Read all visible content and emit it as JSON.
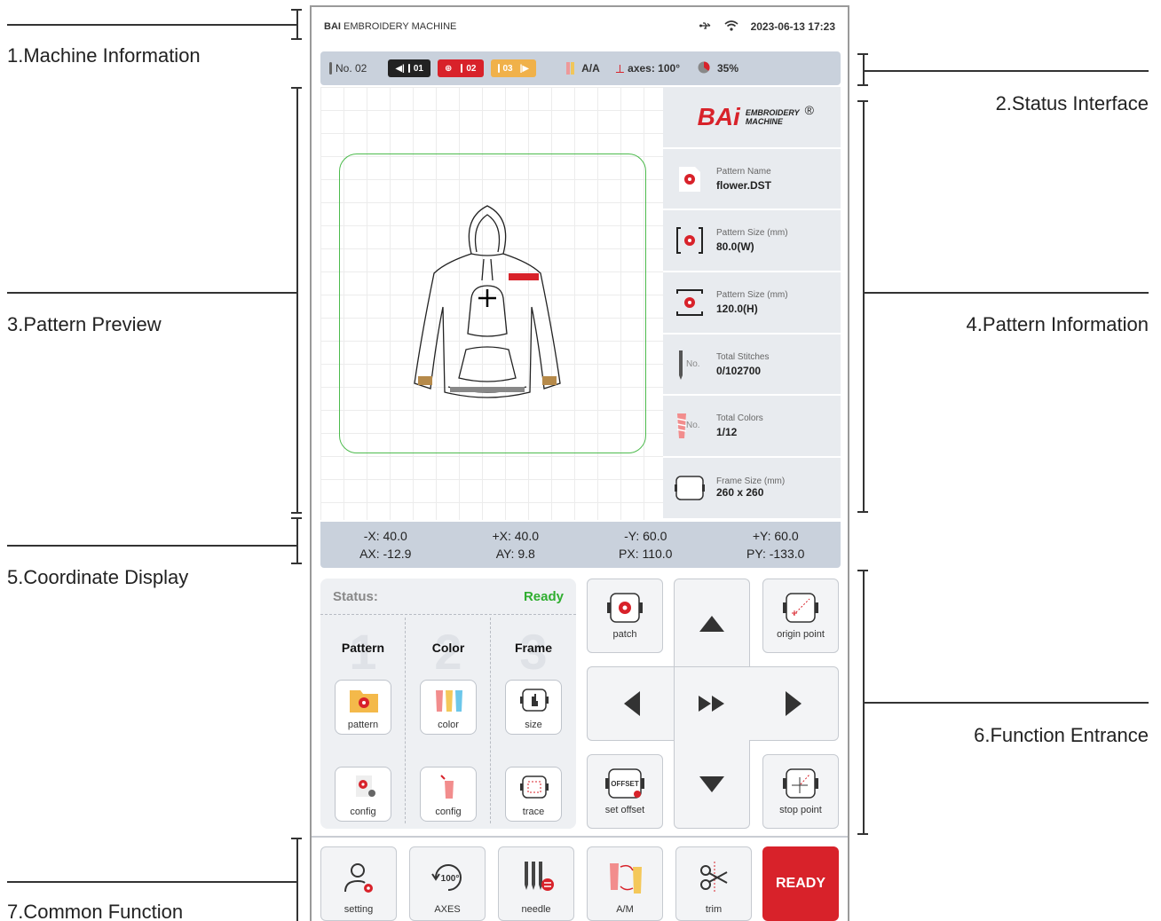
{
  "annotations": {
    "machine_information": "1.Machine Information",
    "status_interface": "2.Status Interface",
    "pattern_preview": "3.Pattern Preview",
    "pattern_information": "4.Pattern Information",
    "coordinate_display": "5.Coordinate Display",
    "function_entrance": "6.Function Entrance",
    "common_function": "7.Common Function"
  },
  "topbar": {
    "brand_bold": "BAI",
    "brand_rest": " EMBROIDERY MACHINE",
    "datetime": "2023-06-13 17:23",
    "icons": [
      "usb-icon",
      "wifi-icon"
    ]
  },
  "statusbar": {
    "needle_no": "No. 02",
    "prev_needle": "01",
    "current_needle": "02",
    "next_needle": "03",
    "mode": "A/A",
    "axes": "axes: 100°",
    "progress_text": "35%",
    "progress_value": 0.35,
    "colors": {
      "prev": "#222222",
      "current": "#d8222a",
      "next": "#f0b14a"
    }
  },
  "logo": {
    "main": "BAi",
    "line1": "EMBROIDERY",
    "line2": "MACHINE",
    "reg": "®"
  },
  "info": [
    {
      "label": "Pattern Name",
      "value": "flower.DST",
      "icon": "pattern-file-icon"
    },
    {
      "label": "Pattern Size (mm)",
      "value": "80.0(W)",
      "icon": "width-icon"
    },
    {
      "label": "Pattern Size (mm)",
      "value": "120.0(H)",
      "icon": "height-icon"
    },
    {
      "label": "Total Stitches",
      "value": "0/102700",
      "icon": "needle-icon",
      "icon_text": "No."
    },
    {
      "label": "Total Colors",
      "value": "1/12",
      "icon": "thread-icon",
      "icon_text": "No."
    },
    {
      "label": "Frame Size (mm)",
      "value": "260 x 260",
      "icon": "frame-icon"
    }
  ],
  "coords": [
    "-X: 40.0",
    "+X: 40.0",
    "-Y: 60.0",
    "+Y: 60.0",
    "AX: -12.9",
    "AY: 9.8",
    "PX: 110.0",
    "PY: -133.0"
  ],
  "flow": {
    "status_label": "Status:",
    "status_value": "Ready",
    "columns": [
      {
        "num": "1",
        "title": "Pattern",
        "btn1": "pattern",
        "btn2": "config"
      },
      {
        "num": "2",
        "title": "Color",
        "btn1": "color",
        "btn2": "config"
      },
      {
        "num": "3",
        "title": "Frame",
        "btn1": "size",
        "btn2": "trace"
      }
    ]
  },
  "grid_buttons": {
    "patch": "patch",
    "origin_point": "origin point",
    "set_offset": "set offset",
    "offset_text": "OFFSET",
    "stop_point": "stop point"
  },
  "bottom": {
    "setting": "setting",
    "axes": "AXES",
    "axes_icon_text": "100°",
    "needle": "needle",
    "am": "A/M",
    "trim": "trim",
    "ready": "READY"
  }
}
